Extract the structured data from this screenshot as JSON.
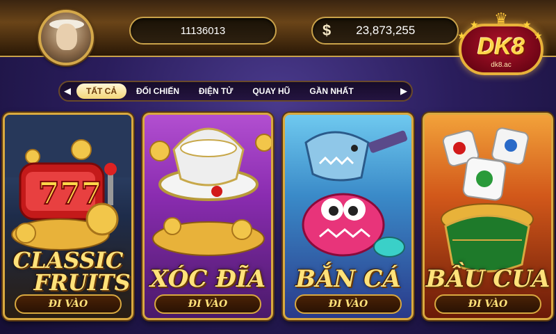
{
  "header": {
    "user_id": "11136013",
    "balance": "23,873,255",
    "currency_symbol": "$"
  },
  "logo": {
    "text": "DK8",
    "sub": "dk8.ac"
  },
  "nav": {
    "tabs": [
      {
        "label": "TẤT CẢ",
        "active": true
      },
      {
        "label": "ĐỐI CHIẾN",
        "active": false
      },
      {
        "label": "ĐIỆN TỬ",
        "active": false
      },
      {
        "label": "QUAY HŨ",
        "active": false
      },
      {
        "label": "GẦN NHẤT",
        "active": false
      }
    ]
  },
  "games": [
    {
      "title_line1": "CLASSIC",
      "title_line2": "FRUITS",
      "button": "ĐI VÀO",
      "icon": "slot-machine-icon"
    },
    {
      "title_line1": "XÓC ĐĨA",
      "title_line2": "",
      "button": "ĐI VÀO",
      "icon": "bowl-icon"
    },
    {
      "title_line1": "BẮN CÁ",
      "title_line2": "",
      "button": "ĐI VÀO",
      "icon": "fish-icon"
    },
    {
      "title_line1": "BẦU CUA",
      "title_line2": "",
      "button": "ĐI VÀO",
      "icon": "dice-icon"
    }
  ],
  "colors": {
    "gold": "#d9a940",
    "title_text": "#ffe27a",
    "background": "#2a1d5c"
  }
}
